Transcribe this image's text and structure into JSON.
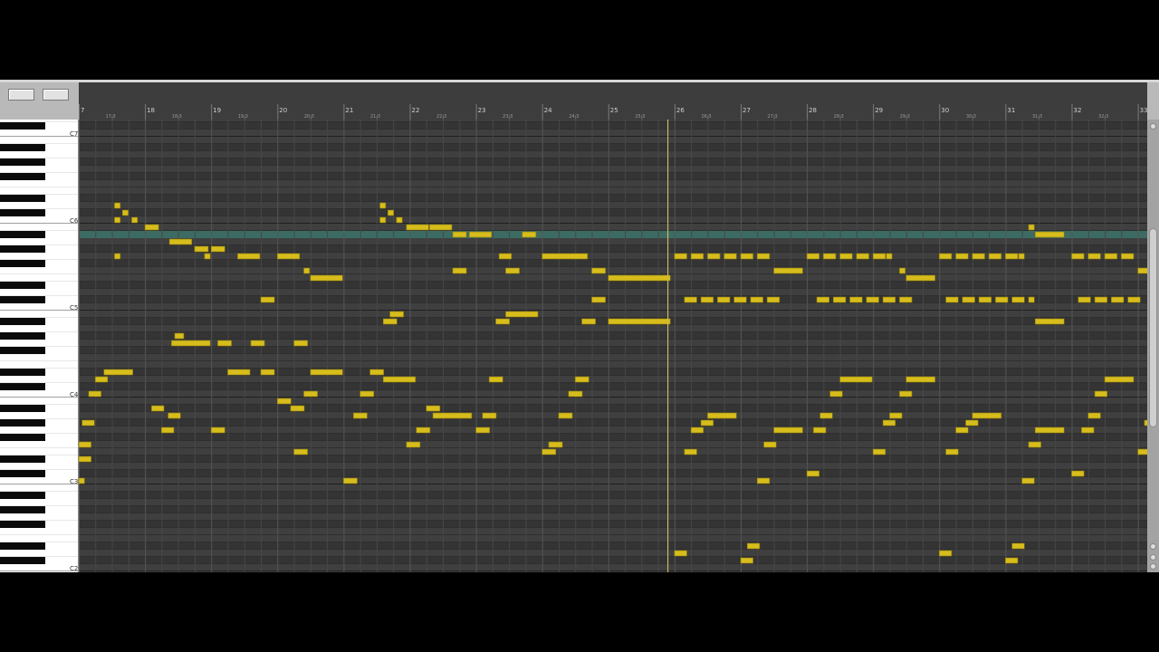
{
  "toolbar": {
    "buttons": [
      "",
      ""
    ]
  },
  "colors": {
    "note": "#d7bd1c",
    "highlight_row": "#3c6b63",
    "playhead": "#c8b860",
    "grid_bg": "#3e3e3e"
  },
  "ruler": {
    "bars": [
      {
        "bar": 17,
        "label": "7",
        "sub": "17.3"
      },
      {
        "bar": 18,
        "label": "18",
        "sub": "18.3"
      },
      {
        "bar": 19,
        "label": "19",
        "sub": "19.3"
      },
      {
        "bar": 20,
        "label": "20",
        "sub": "20.3"
      },
      {
        "bar": 21,
        "label": "21",
        "sub": "21.3"
      },
      {
        "bar": 22,
        "label": "22",
        "sub": "22.3"
      },
      {
        "bar": 23,
        "label": "23",
        "sub": "23.3"
      },
      {
        "bar": 24,
        "label": "24",
        "sub": "24.3"
      },
      {
        "bar": 25,
        "label": "25",
        "sub": "25.3"
      },
      {
        "bar": 26,
        "label": "26",
        "sub": "26.3"
      },
      {
        "bar": 27,
        "label": "27",
        "sub": "27.3"
      },
      {
        "bar": 28,
        "label": "28",
        "sub": "28.3"
      },
      {
        "bar": 29,
        "label": "29",
        "sub": "29.3"
      },
      {
        "bar": 30,
        "label": "30",
        "sub": "30.3"
      },
      {
        "bar": 31,
        "label": "31",
        "sub": "31.3"
      },
      {
        "bar": 32,
        "label": "32",
        "sub": "32.3"
      },
      {
        "bar": 33,
        "label": "33",
        "sub": ""
      }
    ]
  },
  "keyboard": {
    "octave_labels": [
      "C7",
      "C6",
      "C5",
      "C4",
      "C3",
      "C2"
    ]
  },
  "editor": {
    "playhead_bar": 25.9,
    "highlighted_pitch": "A#5",
    "notes": [
      {
        "pitch": "C3",
        "start": 17.0,
        "length": 0.1
      },
      {
        "pitch": "D#3",
        "start": 17.0,
        "length": 0.2
      },
      {
        "pitch": "F3",
        "start": 17.0,
        "length": 0.2
      },
      {
        "pitch": "G#3",
        "start": 17.05,
        "length": 0.2
      },
      {
        "pitch": "C4",
        "start": 17.15,
        "length": 0.2
      },
      {
        "pitch": "D4",
        "start": 17.25,
        "length": 0.2
      },
      {
        "pitch": "D#4",
        "start": 17.38,
        "length": 0.45
      },
      {
        "pitch": "A#3",
        "start": 18.1,
        "length": 0.2
      },
      {
        "pitch": "G3",
        "start": 18.25,
        "length": 0.2
      },
      {
        "pitch": "A3",
        "start": 18.35,
        "length": 0.2
      },
      {
        "pitch": "G4",
        "start": 18.4,
        "length": 0.6
      },
      {
        "pitch": "G#4",
        "start": 18.45,
        "length": 0.15
      },
      {
        "pitch": "G5",
        "start": 17.54,
        "length": 0.1
      },
      {
        "pitch": "C6",
        "start": 17.54,
        "length": 0.1
      },
      {
        "pitch": "D6",
        "start": 17.54,
        "length": 0.1
      },
      {
        "pitch": "C#6",
        "start": 17.66,
        "length": 0.1
      },
      {
        "pitch": "C6",
        "start": 17.8,
        "length": 0.1
      },
      {
        "pitch": "B5",
        "start": 18.0,
        "length": 0.22
      },
      {
        "pitch": "A5",
        "start": 18.37,
        "length": 0.35
      },
      {
        "pitch": "G#5",
        "start": 18.75,
        "length": 0.22
      },
      {
        "pitch": "G5",
        "start": 18.9,
        "length": 0.1
      },
      {
        "pitch": "G#5",
        "start": 19.0,
        "length": 0.22
      },
      {
        "pitch": "G4",
        "start": 19.1,
        "length": 0.22
      },
      {
        "pitch": "G3",
        "start": 19.0,
        "length": 0.22
      },
      {
        "pitch": "G5",
        "start": 19.4,
        "length": 0.35
      },
      {
        "pitch": "D#4",
        "start": 19.25,
        "length": 0.35
      },
      {
        "pitch": "G4",
        "start": 19.6,
        "length": 0.22
      },
      {
        "pitch": "D#4",
        "start": 19.75,
        "length": 0.22
      },
      {
        "pitch": "C#5",
        "start": 19.75,
        "length": 0.22
      },
      {
        "pitch": "B3",
        "start": 20.0,
        "length": 0.22
      },
      {
        "pitch": "G5",
        "start": 20.0,
        "length": 0.35
      },
      {
        "pitch": "E3",
        "start": 20.25,
        "length": 0.22
      },
      {
        "pitch": "A#3",
        "start": 20.2,
        "length": 0.22
      },
      {
        "pitch": "G4",
        "start": 20.25,
        "length": 0.22
      },
      {
        "pitch": "C4",
        "start": 20.4,
        "length": 0.22
      },
      {
        "pitch": "F5",
        "start": 20.4,
        "length": 0.1
      },
      {
        "pitch": "E5",
        "start": 20.5,
        "length": 0.5
      },
      {
        "pitch": "D#4",
        "start": 20.5,
        "length": 0.5
      },
      {
        "pitch": "C3",
        "start": 21.0,
        "length": 0.22
      },
      {
        "pitch": "A3",
        "start": 21.15,
        "length": 0.22
      },
      {
        "pitch": "C4",
        "start": 21.25,
        "length": 0.22
      },
      {
        "pitch": "D#4",
        "start": 21.4,
        "length": 0.22
      },
      {
        "pitch": "D4",
        "start": 21.6,
        "length": 0.5
      },
      {
        "pitch": "A#4",
        "start": 21.6,
        "length": 0.22
      },
      {
        "pitch": "B4",
        "start": 21.7,
        "length": 0.22
      },
      {
        "pitch": "D6",
        "start": 21.55,
        "length": 0.1
      },
      {
        "pitch": "C#6",
        "start": 21.67,
        "length": 0.1
      },
      {
        "pitch": "C6",
        "start": 21.55,
        "length": 0.1
      },
      {
        "pitch": "C6",
        "start": 21.8,
        "length": 0.1
      },
      {
        "pitch": "B5",
        "start": 21.95,
        "length": 0.35
      },
      {
        "pitch": "B5",
        "start": 22.3,
        "length": 0.35
      },
      {
        "pitch": "F3",
        "start": 21.95,
        "length": 0.22
      },
      {
        "pitch": "G3",
        "start": 22.1,
        "length": 0.22
      },
      {
        "pitch": "A#3",
        "start": 22.25,
        "length": 0.22
      },
      {
        "pitch": "A3",
        "start": 22.35,
        "length": 0.6
      },
      {
        "pitch": "A#5",
        "start": 22.65,
        "length": 0.22
      },
      {
        "pitch": "A#5",
        "start": 22.9,
        "length": 0.35
      },
      {
        "pitch": "F5",
        "start": 22.65,
        "length": 0.22
      },
      {
        "pitch": "G3",
        "start": 23.0,
        "length": 0.22
      },
      {
        "pitch": "A3",
        "start": 23.1,
        "length": 0.22
      },
      {
        "pitch": "D4",
        "start": 23.2,
        "length": 0.22
      },
      {
        "pitch": "A#4",
        "start": 23.3,
        "length": 0.22
      },
      {
        "pitch": "B4",
        "start": 23.45,
        "length": 0.5
      },
      {
        "pitch": "G5",
        "start": 23.35,
        "length": 0.2
      },
      {
        "pitch": "F5",
        "start": 23.45,
        "length": 0.22
      },
      {
        "pitch": "A#5",
        "start": 23.7,
        "length": 0.22
      },
      {
        "pitch": "E3",
        "start": 24.0,
        "length": 0.22
      },
      {
        "pitch": "G5",
        "start": 24.0,
        "length": 0.7
      },
      {
        "pitch": "F3",
        "start": 24.1,
        "length": 0.22
      },
      {
        "pitch": "A3",
        "start": 24.25,
        "length": 0.22
      },
      {
        "pitch": "C4",
        "start": 24.4,
        "length": 0.22
      },
      {
        "pitch": "D4",
        "start": 24.5,
        "length": 0.22
      },
      {
        "pitch": "A#4",
        "start": 24.6,
        "length": 0.22
      },
      {
        "pitch": "C#5",
        "start": 24.75,
        "length": 0.22
      },
      {
        "pitch": "F5",
        "start": 24.75,
        "length": 0.22
      },
      {
        "pitch": "E5",
        "start": 25.0,
        "length": 0.95
      },
      {
        "pitch": "A#4",
        "start": 25.0,
        "length": 0.95
      },
      {
        "pitch": "D2",
        "start": 26.0,
        "length": 0.2
      },
      {
        "pitch": "E3",
        "start": 26.15,
        "length": 0.2
      },
      {
        "pitch": "G3",
        "start": 26.25,
        "length": 0.2
      },
      {
        "pitch": "G#3",
        "start": 26.4,
        "length": 0.2
      },
      {
        "pitch": "A3",
        "start": 26.5,
        "length": 0.45
      },
      {
        "pitch": "G5",
        "start": 26.0,
        "length": 0.2
      },
      {
        "pitch": "G5",
        "start": 26.25,
        "length": 0.2
      },
      {
        "pitch": "G5",
        "start": 26.5,
        "length": 0.2
      },
      {
        "pitch": "G5",
        "start": 26.75,
        "length": 0.2
      },
      {
        "pitch": "G5",
        "start": 27.0,
        "length": 0.2
      },
      {
        "pitch": "G5",
        "start": 27.25,
        "length": 0.2
      },
      {
        "pitch": "C#5",
        "start": 26.15,
        "length": 0.2
      },
      {
        "pitch": "C#5",
        "start": 26.4,
        "length": 0.2
      },
      {
        "pitch": "C#5",
        "start": 26.65,
        "length": 0.2
      },
      {
        "pitch": "C#5",
        "start": 26.9,
        "length": 0.2
      },
      {
        "pitch": "C#5",
        "start": 27.15,
        "length": 0.2
      },
      {
        "pitch": "C#5",
        "start": 27.4,
        "length": 0.2
      },
      {
        "pitch": "C#2",
        "start": 27.0,
        "length": 0.2
      },
      {
        "pitch": "D#2",
        "start": 27.1,
        "length": 0.2
      },
      {
        "pitch": "C3",
        "start": 27.25,
        "length": 0.2
      },
      {
        "pitch": "F3",
        "start": 27.35,
        "length": 0.2
      },
      {
        "pitch": "G3",
        "start": 27.5,
        "length": 0.45
      },
      {
        "pitch": "F5",
        "start": 27.5,
        "length": 0.45
      },
      {
        "pitch": "C#3",
        "start": 28.0,
        "length": 0.2
      },
      {
        "pitch": "G3",
        "start": 28.1,
        "length": 0.2
      },
      {
        "pitch": "A3",
        "start": 28.2,
        "length": 0.2
      },
      {
        "pitch": "C4",
        "start": 28.35,
        "length": 0.2
      },
      {
        "pitch": "D4",
        "start": 28.5,
        "length": 0.5
      },
      {
        "pitch": "G5",
        "start": 28.0,
        "length": 0.2
      },
      {
        "pitch": "G5",
        "start": 28.25,
        "length": 0.2
      },
      {
        "pitch": "G5",
        "start": 28.5,
        "length": 0.2
      },
      {
        "pitch": "G5",
        "start": 28.75,
        "length": 0.2
      },
      {
        "pitch": "G5",
        "start": 29.0,
        "length": 0.2
      },
      {
        "pitch": "G5",
        "start": 29.2,
        "length": 0.1
      },
      {
        "pitch": "C#5",
        "start": 28.15,
        "length": 0.2
      },
      {
        "pitch": "C#5",
        "start": 28.4,
        "length": 0.2
      },
      {
        "pitch": "C#5",
        "start": 28.65,
        "length": 0.2
      },
      {
        "pitch": "C#5",
        "start": 28.9,
        "length": 0.2
      },
      {
        "pitch": "C#5",
        "start": 29.15,
        "length": 0.2
      },
      {
        "pitch": "C#5",
        "start": 29.4,
        "length": 0.2
      },
      {
        "pitch": "E3",
        "start": 29.0,
        "length": 0.2
      },
      {
        "pitch": "G#3",
        "start": 29.15,
        "length": 0.2
      },
      {
        "pitch": "A3",
        "start": 29.25,
        "length": 0.2
      },
      {
        "pitch": "C4",
        "start": 29.4,
        "length": 0.2
      },
      {
        "pitch": "D4",
        "start": 29.5,
        "length": 0.45
      },
      {
        "pitch": "F5",
        "start": 29.4,
        "length": 0.1
      },
      {
        "pitch": "E5",
        "start": 29.5,
        "length": 0.45
      },
      {
        "pitch": "D2",
        "start": 30.0,
        "length": 0.2
      },
      {
        "pitch": "E3",
        "start": 30.1,
        "length": 0.2
      },
      {
        "pitch": "G3",
        "start": 30.25,
        "length": 0.2
      },
      {
        "pitch": "G#3",
        "start": 30.4,
        "length": 0.2
      },
      {
        "pitch": "A3",
        "start": 30.5,
        "length": 0.45
      },
      {
        "pitch": "G5",
        "start": 30.0,
        "length": 0.2
      },
      {
        "pitch": "G5",
        "start": 30.25,
        "length": 0.2
      },
      {
        "pitch": "G5",
        "start": 30.5,
        "length": 0.2
      },
      {
        "pitch": "G5",
        "start": 30.75,
        "length": 0.2
      },
      {
        "pitch": "G5",
        "start": 31.0,
        "length": 0.2
      },
      {
        "pitch": "G5",
        "start": 31.2,
        "length": 0.1
      },
      {
        "pitch": "C#5",
        "start": 30.1,
        "length": 0.2
      },
      {
        "pitch": "C#5",
        "start": 30.35,
        "length": 0.2
      },
      {
        "pitch": "C#5",
        "start": 30.6,
        "length": 0.2
      },
      {
        "pitch": "C#5",
        "start": 30.85,
        "length": 0.2
      },
      {
        "pitch": "C#5",
        "start": 31.1,
        "length": 0.2
      },
      {
        "pitch": "C#5",
        "start": 31.35,
        "length": 0.1
      },
      {
        "pitch": "C#2",
        "start": 31.0,
        "length": 0.2
      },
      {
        "pitch": "D#2",
        "start": 31.1,
        "length": 0.2
      },
      {
        "pitch": "C3",
        "start": 31.25,
        "length": 0.2
      },
      {
        "pitch": "F3",
        "start": 31.35,
        "length": 0.2
      },
      {
        "pitch": "G3",
        "start": 31.45,
        "length": 0.45
      },
      {
        "pitch": "B5",
        "start": 31.35,
        "length": 0.1
      },
      {
        "pitch": "A#5",
        "start": 31.45,
        "length": 0.45
      },
      {
        "pitch": "A#4",
        "start": 31.45,
        "length": 0.45
      },
      {
        "pitch": "C#3",
        "start": 32.0,
        "length": 0.2
      },
      {
        "pitch": "G3",
        "start": 32.15,
        "length": 0.2
      },
      {
        "pitch": "A3",
        "start": 32.25,
        "length": 0.2
      },
      {
        "pitch": "C4",
        "start": 32.35,
        "length": 0.2
      },
      {
        "pitch": "D4",
        "start": 32.5,
        "length": 0.45
      },
      {
        "pitch": "G5",
        "start": 32.0,
        "length": 0.2
      },
      {
        "pitch": "G5",
        "start": 32.25,
        "length": 0.2
      },
      {
        "pitch": "G5",
        "start": 32.5,
        "length": 0.2
      },
      {
        "pitch": "G5",
        "start": 32.75,
        "length": 0.2
      },
      {
        "pitch": "C#5",
        "start": 32.1,
        "length": 0.2
      },
      {
        "pitch": "C#5",
        "start": 32.35,
        "length": 0.2
      },
      {
        "pitch": "C#5",
        "start": 32.6,
        "length": 0.2
      },
      {
        "pitch": "C#5",
        "start": 32.85,
        "length": 0.2
      },
      {
        "pitch": "F5",
        "start": 33.0,
        "length": 0.2
      },
      {
        "pitch": "E3",
        "start": 33.0,
        "length": 0.2
      },
      {
        "pitch": "G#3",
        "start": 33.1,
        "length": 0.2
      }
    ]
  }
}
